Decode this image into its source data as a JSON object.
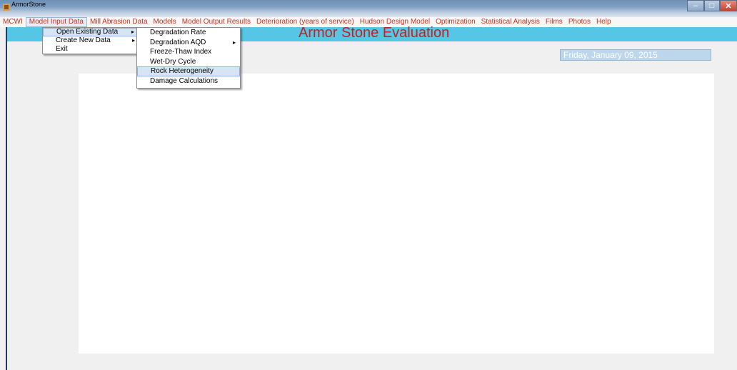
{
  "window": {
    "title": "ArmorStone",
    "controls": {
      "minimize": "–",
      "maximize": "□",
      "close": "✕"
    }
  },
  "menubar": {
    "items": [
      {
        "label": "MCWI"
      },
      {
        "label": "Model Input Data"
      },
      {
        "label": "Mill Abrasion Data"
      },
      {
        "label": "Models"
      },
      {
        "label": "Model Output Results"
      },
      {
        "label": "Deterioration (years of service)"
      },
      {
        "label": "Hudson Design Model"
      },
      {
        "label": "Optimization"
      },
      {
        "label": "Statistical Analysis"
      },
      {
        "label": "Films"
      },
      {
        "label": "Photos"
      },
      {
        "label": "Help"
      }
    ]
  },
  "header": {
    "title": "Armor Stone Evaluation",
    "color": "#56c6e6"
  },
  "date_display": {
    "value": "Friday, January 09, 2015"
  },
  "dropdown_model_input": {
    "items": [
      {
        "label": "Open Existing Data",
        "arrow": "▸"
      },
      {
        "label": "Create New Data",
        "arrow": "▸"
      },
      {
        "label": "Exit",
        "arrow": ""
      }
    ]
  },
  "dropdown_open_existing": {
    "items": [
      {
        "label": "Degradation Rate",
        "arrow": ""
      },
      {
        "label": "Degradation AQD",
        "arrow": "▸"
      },
      {
        "label": "Freeze-Thaw Index",
        "arrow": ""
      },
      {
        "label": "Wet-Dry Cycle",
        "arrow": ""
      },
      {
        "label": "Rock Heterogeneity",
        "arrow": ""
      },
      {
        "label": "Damage Calculations",
        "arrow": ""
      }
    ]
  },
  "colors": {
    "menu_text": "#c8321e",
    "title_text": "#c81e1e"
  }
}
